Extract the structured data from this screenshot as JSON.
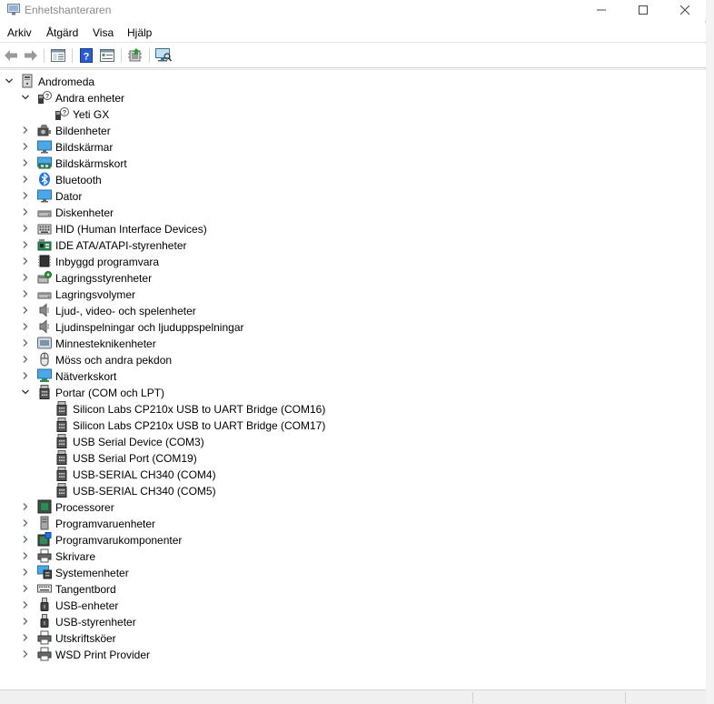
{
  "window": {
    "title": "Enhetshanteraren"
  },
  "menu": [
    "Arkiv",
    "Åtgärd",
    "Visa",
    "Hjälp"
  ],
  "toolbar": [
    {
      "name": "back-button",
      "icon": "arrow-left-icon"
    },
    {
      "name": "forward-button",
      "icon": "arrow-right-icon"
    },
    {
      "name": "show-hide-console-tree-button",
      "icon": "console-tree-icon"
    },
    {
      "name": "help-button",
      "icon": "help-icon"
    },
    {
      "name": "properties-button",
      "icon": "properties-icon"
    },
    {
      "name": "update-driver-button",
      "icon": "update-driver-icon"
    },
    {
      "name": "scan-hardware-button",
      "icon": "monitor-scan-icon"
    }
  ],
  "tree": {
    "root": "Andromeda",
    "items": [
      {
        "label": "Andromeda",
        "level": 0,
        "expanded": true,
        "icon": "computer-icon"
      },
      {
        "label": "Andra enheter",
        "level": 1,
        "expanded": true,
        "icon": "unknown-device-icon"
      },
      {
        "label": "Yeti GX",
        "level": 2,
        "icon": "unknown-device-icon"
      },
      {
        "label": "Bildenheter",
        "level": 1,
        "expanded": false,
        "icon": "camera-icon"
      },
      {
        "label": "Bildskärmar",
        "level": 1,
        "expanded": false,
        "icon": "monitor-icon"
      },
      {
        "label": "Bildskärmskort",
        "level": 1,
        "expanded": false,
        "icon": "display-adapter-icon"
      },
      {
        "label": "Bluetooth",
        "level": 1,
        "expanded": false,
        "icon": "bluetooth-icon"
      },
      {
        "label": "Dator",
        "level": 1,
        "expanded": false,
        "icon": "monitor-icon"
      },
      {
        "label": "Diskenheter",
        "level": 1,
        "expanded": false,
        "icon": "disk-drive-icon"
      },
      {
        "label": "HID (Human Interface Devices)",
        "level": 1,
        "expanded": false,
        "icon": "hid-icon"
      },
      {
        "label": "IDE ATA/ATAPI-styrenheter",
        "level": 1,
        "expanded": false,
        "icon": "ide-controller-icon"
      },
      {
        "label": "Inbyggd programvara",
        "level": 1,
        "expanded": false,
        "icon": "firmware-icon"
      },
      {
        "label": "Lagringsstyrenheter",
        "level": 1,
        "expanded": false,
        "icon": "storage-controller-icon"
      },
      {
        "label": "Lagringsvolymer",
        "level": 1,
        "expanded": false,
        "icon": "disk-drive-icon"
      },
      {
        "label": "Ljud-, video- och spelenheter",
        "level": 1,
        "expanded": false,
        "icon": "speaker-icon"
      },
      {
        "label": "Ljudinspelningar och ljuduppspelningar",
        "level": 1,
        "expanded": false,
        "icon": "speaker-icon"
      },
      {
        "label": "Minnesteknikenheter",
        "level": 1,
        "expanded": false,
        "icon": "memory-icon"
      },
      {
        "label": "Möss och andra pekdon",
        "level": 1,
        "expanded": false,
        "icon": "mouse-icon"
      },
      {
        "label": "Nätverkskort",
        "level": 1,
        "expanded": false,
        "icon": "network-adapter-icon"
      },
      {
        "label": "Portar (COM och LPT)",
        "level": 1,
        "expanded": true,
        "icon": "port-icon"
      },
      {
        "label": "Silicon Labs CP210x USB to UART Bridge (COM16)",
        "level": 2,
        "icon": "port-icon"
      },
      {
        "label": "Silicon Labs CP210x USB to UART Bridge (COM17)",
        "level": 2,
        "icon": "port-icon"
      },
      {
        "label": "USB Serial Device (COM3)",
        "level": 2,
        "icon": "port-icon"
      },
      {
        "label": "USB Serial Port (COM19)",
        "level": 2,
        "icon": "port-icon"
      },
      {
        "label": "USB-SERIAL CH340 (COM4)",
        "level": 2,
        "icon": "port-icon"
      },
      {
        "label": "USB-SERIAL CH340 (COM5)",
        "level": 2,
        "icon": "port-icon"
      },
      {
        "label": "Processorer",
        "level": 1,
        "expanded": false,
        "icon": "processor-icon"
      },
      {
        "label": "Programvaruenheter",
        "level": 1,
        "expanded": false,
        "icon": "software-device-icon"
      },
      {
        "label": "Programvarukomponenter",
        "level": 1,
        "expanded": false,
        "icon": "software-component-icon"
      },
      {
        "label": "Skrivare",
        "level": 1,
        "expanded": false,
        "icon": "printer-icon"
      },
      {
        "label": "Systemenheter",
        "level": 1,
        "expanded": false,
        "icon": "system-device-icon"
      },
      {
        "label": "Tangentbord",
        "level": 1,
        "expanded": false,
        "icon": "keyboard-icon"
      },
      {
        "label": "USB-enheter",
        "level": 1,
        "expanded": false,
        "icon": "usb-icon"
      },
      {
        "label": "USB-styrenheter",
        "level": 1,
        "expanded": false,
        "icon": "usb-icon"
      },
      {
        "label": "Utskriftsköer",
        "level": 1,
        "expanded": false,
        "icon": "printer-icon"
      },
      {
        "label": "WSD Print Provider",
        "level": 1,
        "expanded": false,
        "icon": "printer-icon"
      }
    ]
  },
  "colors": {
    "accent": "#0078d4",
    "title_text": "#8a8a8a",
    "window_bg": "#ffffff",
    "frame_bg": "#f3f3f3"
  }
}
